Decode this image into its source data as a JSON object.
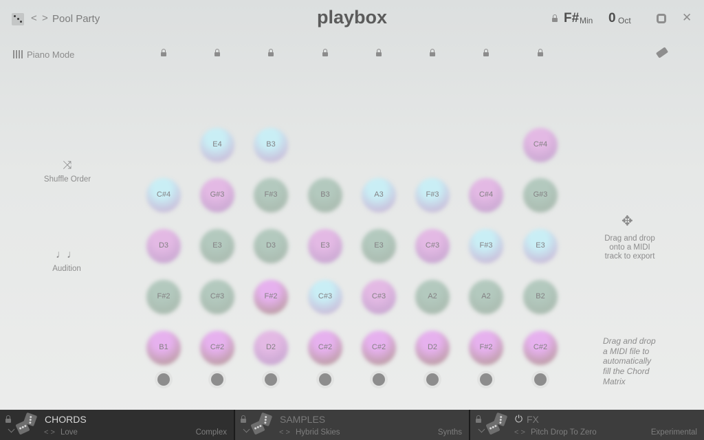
{
  "header": {
    "preset_name": "Pool Party",
    "logo": "playbox",
    "key_note": "F#",
    "key_mode": "Min",
    "octave_value": "0",
    "octave_label": "Oct",
    "prev_symbol": "<",
    "next_symbol": ">",
    "close_symbol": "✕",
    "icons": [
      "dice-icon",
      "chevron-left-icon",
      "chevron-right-icon",
      "lock-icon",
      "gear-icon",
      "close-icon"
    ]
  },
  "toolbar": {
    "piano_mode_label": "Piano Mode",
    "column_locks": 8,
    "icons": [
      "piano-icon",
      "lock-icon",
      "eraser-icon"
    ]
  },
  "side": {
    "shuffle_label": "Shuffle Order",
    "shuffle_icon": "⤨",
    "audition_label": "Audition",
    "audition_icon": "♩♩"
  },
  "right": {
    "move_icon": "✥",
    "export_hint": "Drag and drop onto a MIDI track to export",
    "export_lines": [
      "Drag and drop",
      "onto a MIDI",
      "track to export"
    ],
    "import_lines": [
      "Drag and drop",
      "a MIDI file to",
      "automatically",
      "fill the Chord",
      "Matrix"
    ]
  },
  "matrix": {
    "columns": [
      {
        "notes": [
          null,
          "C#4",
          "D3",
          "F#2",
          "B1"
        ],
        "colors": [
          null,
          "blue",
          "pink",
          "green",
          "violet"
        ]
      },
      {
        "notes": [
          "E4",
          "G#3",
          "E3",
          "C#3",
          "C#2"
        ],
        "colors": [
          "blue",
          "pink",
          "green",
          "green",
          "violet"
        ]
      },
      {
        "notes": [
          "B3",
          "F#3",
          "D3",
          "F#2",
          "D2"
        ],
        "colors": [
          "blue",
          "green",
          "green",
          "violet",
          "pink"
        ]
      },
      {
        "notes": [
          null,
          "B3",
          "E3",
          "C#3",
          "C#2"
        ],
        "colors": [
          null,
          "green",
          "pink",
          "blue",
          "violet"
        ]
      },
      {
        "notes": [
          null,
          "A3",
          "E3",
          "C#3",
          "C#2"
        ],
        "colors": [
          null,
          "blue",
          "green",
          "pink",
          "violet"
        ]
      },
      {
        "notes": [
          null,
          "F#3",
          "C#3",
          "A2",
          "D2"
        ],
        "colors": [
          null,
          "blue",
          "pink",
          "green",
          "violet"
        ]
      },
      {
        "notes": [
          null,
          "C#4",
          "F#3",
          "A2",
          "F#2"
        ],
        "colors": [
          null,
          "pink",
          "blue",
          "green",
          "violet"
        ]
      },
      {
        "notes": [
          "C#4",
          "G#3",
          "E3",
          "B2",
          "C#2"
        ],
        "colors": [
          "pink",
          "green",
          "blue",
          "green",
          "violet"
        ]
      }
    ],
    "palette": {
      "blue": [
        "#c9eef5",
        "#c9b6d6"
      ],
      "pink": [
        "#e3b9e4",
        "#c6a6cf"
      ],
      "green": [
        "#b3c9be",
        "#a9b9ae"
      ],
      "violet": [
        "#e6b1ee",
        "#b79a9c"
      ]
    }
  },
  "bottom": {
    "panels": [
      {
        "title": "CHORDS",
        "preset": "Love",
        "category": "Complex",
        "active": true
      },
      {
        "title": "SAMPLES",
        "preset": "Hybrid Skies",
        "category": "Synths",
        "active": false
      },
      {
        "title": "FX",
        "preset": "Pitch Drop To Zero",
        "category": "Experimental",
        "active": false,
        "power_icon": "⏻"
      }
    ],
    "nav_symbol": "< >"
  }
}
